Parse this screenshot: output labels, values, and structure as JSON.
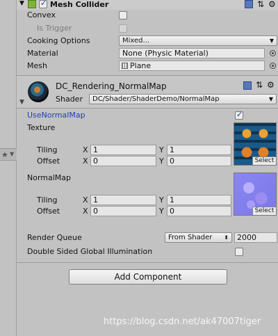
{
  "mesh_collider": {
    "title": "Mesh Collider",
    "convex_label": "Convex",
    "is_trigger_label": "Is Trigger",
    "cooking_label": "Cooking Options",
    "cooking_value": "Mixed...",
    "material_label": "Material",
    "material_value": "None (Physic Material)",
    "mesh_label": "Mesh",
    "mesh_value": "Plane"
  },
  "material": {
    "name": "DC_Rendering_NormalMap",
    "shader_label": "Shader",
    "shader_value": "DC/Shader/ShaderDemo/NormalMap"
  },
  "properties": {
    "use_normal_map_label": "UseNormalMap",
    "texture_label": "Texture",
    "tiling_label": "Tiling",
    "offset_label": "Offset",
    "x_label": "X",
    "y_label": "Y",
    "texture_tiling_x": "1",
    "texture_tiling_y": "1",
    "texture_offset_x": "0",
    "texture_offset_y": "0",
    "normalmap_label": "NormalMap",
    "normal_tiling_x": "1",
    "normal_tiling_y": "1",
    "normal_offset_x": "0",
    "normal_offset_y": "0",
    "select_label": "Select",
    "render_queue_label": "Render Queue",
    "render_queue_mode": "From Shader",
    "render_queue_value": "2000",
    "double_sided_label": "Double Sided Global Illumination"
  },
  "add_component_label": "Add Component",
  "watermark": "https://blog.csdn.net/ak47007tiger",
  "colors": {
    "background": "#c2c2c2",
    "accent_label": "#1f3fb0"
  }
}
